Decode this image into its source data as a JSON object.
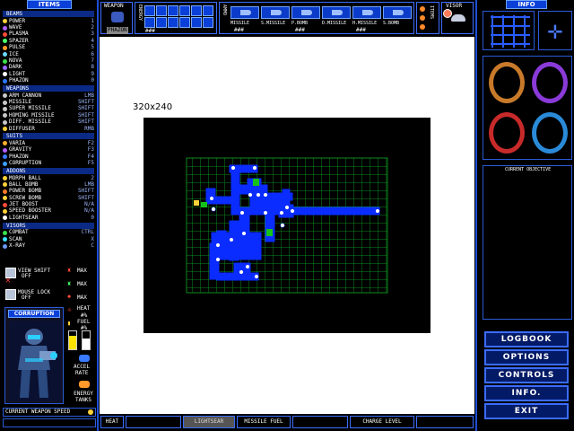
{
  "items_header": "ITEMS",
  "beams": {
    "header": "BEAMS",
    "items": [
      {
        "label": "POWER",
        "key": "1",
        "color": "#ffd23a"
      },
      {
        "label": "WAVE",
        "key": "2",
        "color": "#b060ff"
      },
      {
        "label": "PLASMA",
        "key": "3",
        "color": "#ff4a3a"
      },
      {
        "label": "SPAZER",
        "key": "4",
        "color": "#4aff6a"
      },
      {
        "label": "PULSE",
        "key": "5",
        "color": "#ff9a2a"
      },
      {
        "label": "ICE",
        "key": "6",
        "color": "#6ad8ff"
      },
      {
        "label": "NOVA",
        "key": "7",
        "color": "#3ae04a"
      },
      {
        "label": "DARK",
        "key": "8",
        "color": "#9a6aff"
      },
      {
        "label": "LIGHT",
        "key": "9",
        "color": "#ffffff"
      },
      {
        "label": "PHAZON",
        "key": "0",
        "color": "#2a7aff"
      }
    ]
  },
  "weapons": {
    "header": "WEAPONS",
    "items": [
      {
        "label": "ARM CANNON",
        "key": "LMB",
        "color": "#c8c8c8"
      },
      {
        "label": "MISSILE",
        "key": "SHIFT",
        "color": "#c8c8c8"
      },
      {
        "label": "SUPER MISSILE",
        "key": "SHIFT",
        "color": "#c8c8c8"
      },
      {
        "label": "HOMING MISSILE",
        "key": "SHIFT",
        "color": "#c8c8c8"
      },
      {
        "label": "DIFF. MISSILE",
        "key": "SHIFT",
        "color": "#c8c8c8"
      },
      {
        "label": "DIFFUSER",
        "key": "RMB",
        "color": "#ffd23a"
      }
    ]
  },
  "suits": {
    "header": "SUITS",
    "items": [
      {
        "label": "VARIA",
        "key": "F2",
        "color": "#ffb02a"
      },
      {
        "label": "GRAVITY",
        "key": "F3",
        "color": "#b060ff"
      },
      {
        "label": "PHAZON",
        "key": "F4",
        "color": "#3a7aff"
      },
      {
        "label": "CORRUPTION",
        "key": "F5",
        "color": "#3aa0ff"
      }
    ]
  },
  "addons": {
    "header": "ADDONS",
    "items": [
      {
        "label": "MORPH BALL",
        "key": "2",
        "color": "#ffd23a"
      },
      {
        "label": "BALL BOMB",
        "key": "LMB",
        "color": "#ffd23a"
      },
      {
        "label": "POWER BOMB",
        "key": "SHIFT",
        "color": "#ff7a2a"
      },
      {
        "label": "SCREW BOMB",
        "key": "SHIFT",
        "color": "#ffd23a"
      },
      {
        "label": "JET BOOST",
        "key": "N/A",
        "color": "#ff4a3a"
      },
      {
        "label": "SPEED BOOSTER",
        "key": "N/A",
        "color": "#ffd23a"
      },
      {
        "label": "LIGHTSEAR",
        "key": "0",
        "color": "#ffffff"
      }
    ]
  },
  "visors": {
    "header": "VISORS",
    "items": [
      {
        "label": "COMBAT",
        "key": "CTRL",
        "color": "#3ae04a"
      },
      {
        "label": "SCAN",
        "key": "X",
        "color": "#3ae0ff"
      },
      {
        "label": "X-RAY",
        "key": "C",
        "color": "#6a9aff"
      }
    ]
  },
  "toggles": [
    {
      "label": "VIEW SHIFT",
      "state": "OFF"
    },
    {
      "label": "MOUSE LOCK",
      "state": "OFF"
    }
  ],
  "max_labels": [
    "MAX",
    "MAX",
    "MAX"
  ],
  "suit_preview_label": "CORRUPTION",
  "heat": {
    "label": "HEAT",
    "value": "#%"
  },
  "fuel": {
    "label": "FUEL",
    "value": "#%"
  },
  "fill_levels": {
    "heat": 0.75,
    "fuel": 0.6
  },
  "accel_label": "ACCEL",
  "rate_label": "RATE",
  "energy_tanks_label": "ENERGY TANKS",
  "current_weapon_speed": "CURRENT WEAPON SPEED",
  "top": {
    "weapon_label": "WEAPON",
    "weapon_name": "PHAZON",
    "energy_label": "ENERGY",
    "energy_value": "###",
    "ammo_label": "AMMO",
    "missiles": [
      {
        "label": "MISSILE",
        "value": "###"
      },
      {
        "label": "S.MISSILE",
        "value": "###"
      },
      {
        "label": "P.BOMB",
        "value": "###"
      },
      {
        "label": "D.MISSILE",
        "value": "###"
      },
      {
        "label": "H.MISSILE",
        "value": "###"
      },
      {
        "label": "S.BOMB",
        "value": "###"
      }
    ],
    "items_label": "ITEMS",
    "visor_label": "VISOR"
  },
  "info_header": "INFO",
  "current_objective_label": "CURRENT OBJECTIVE",
  "menu": [
    "LOGBOOK",
    "OPTIONS",
    "CONTROLS",
    "INFO.",
    "EXIT"
  ],
  "viewport_label": "320x240",
  "bottom_bar": [
    "HEAT",
    "",
    "LIGHTSEAR",
    "MISSILE FUEL",
    "",
    "CHARGE LEVEL",
    ""
  ]
}
